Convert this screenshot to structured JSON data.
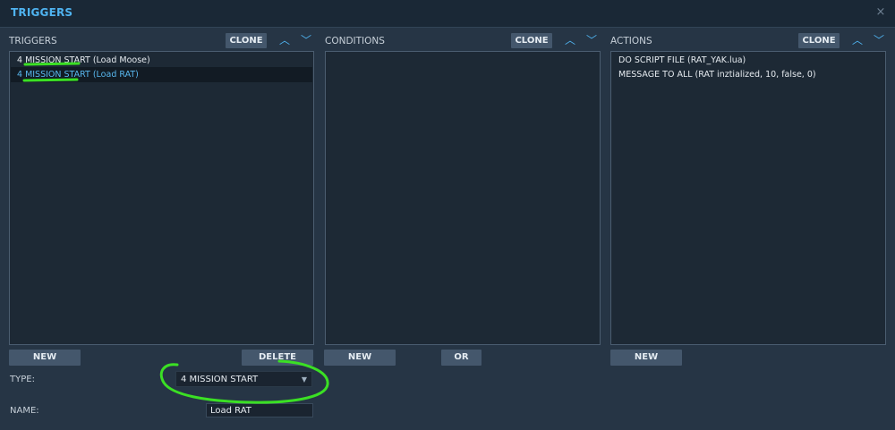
{
  "window": {
    "title": "TRIGGERS",
    "close_glyph": "×"
  },
  "triggers": {
    "header": "TRIGGERS",
    "clone_label": "CLONE",
    "up_glyph": "︿",
    "down_glyph": "﹀",
    "items": [
      {
        "label": "4 MISSION START (Load Moose)",
        "selected": false
      },
      {
        "label": "4 MISSION START (Load RAT)",
        "selected": true
      }
    ],
    "new_label": "NEW",
    "delete_label": "DELETE"
  },
  "conditions": {
    "header": "CONDITIONS",
    "clone_label": "CLONE",
    "up_glyph": "︿",
    "down_glyph": "﹀",
    "items": [],
    "new_label": "NEW",
    "or_label": "OR"
  },
  "actions": {
    "header": "ACTIONS",
    "clone_label": "CLONE",
    "up_glyph": "︿",
    "down_glyph": "﹀",
    "items": [
      {
        "label": "DO SCRIPT FILE (RAT_YAK.lua)"
      },
      {
        "label": "MESSAGE TO ALL (RAT inztialized, 10, false, 0)"
      }
    ],
    "new_label": "NEW"
  },
  "properties": {
    "type_label": "TYPE:",
    "type_value": "4 MISSION START",
    "name_label": "NAME:",
    "name_value": "Load RAT"
  },
  "colors": {
    "accent": "#4fb3f0",
    "annotation": "#3be024"
  }
}
